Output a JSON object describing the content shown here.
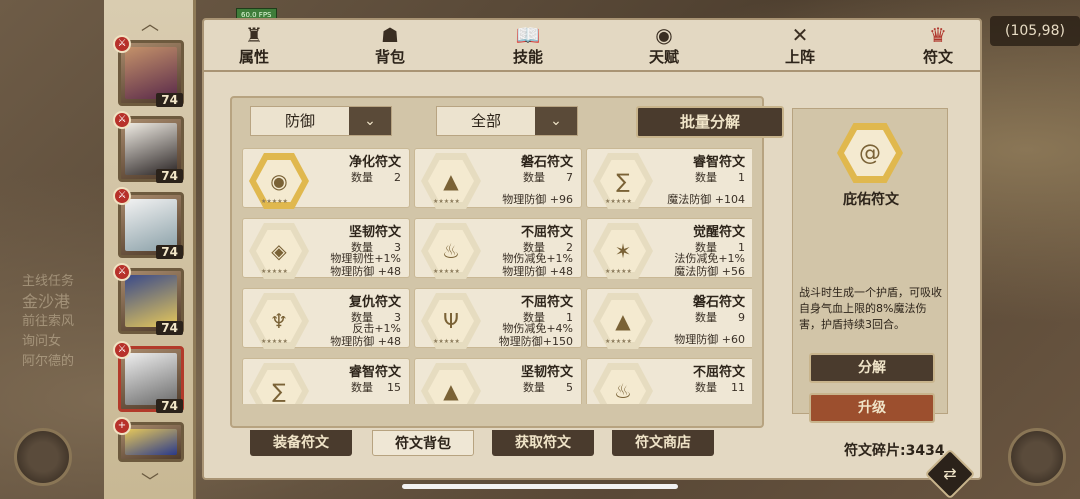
{
  "fps": "60.0 FPS",
  "coins": "(105,98)",
  "background_text": {
    "line1": "主线任务",
    "line2": "金沙港",
    "line3": "前往索风",
    "line4": "询问女",
    "line5": "阿尔德的"
  },
  "heroes": [
    {
      "level": "74"
    },
    {
      "level": "74"
    },
    {
      "level": "74"
    },
    {
      "level": "74"
    },
    {
      "level": "74"
    },
    {
      "level": ""
    }
  ],
  "tabs": [
    {
      "label": "属性",
      "icon": "attribute-icon"
    },
    {
      "label": "背包",
      "icon": "backpack-icon"
    },
    {
      "label": "技能",
      "icon": "skill-book-icon"
    },
    {
      "label": "天赋",
      "icon": "talent-eye-icon"
    },
    {
      "label": "上阵",
      "icon": "crossed-swords-icon"
    },
    {
      "label": "符文",
      "icon": "rune-icon"
    }
  ],
  "filters": {
    "type": "防御",
    "scope": "全部"
  },
  "batch_decompose": "批量分解",
  "qty_label": "数量",
  "runes": [
    {
      "name": "净化符文",
      "qty": "2",
      "stats": [],
      "gold": true
    },
    {
      "name": "磐石符文",
      "qty": "7",
      "stats": [
        "物理防御 +96"
      ],
      "gold": false
    },
    {
      "name": "睿智符文",
      "qty": "1",
      "stats": [
        "魔法防御 +104"
      ],
      "gold": false
    },
    {
      "name": "坚韧符文",
      "qty": "3",
      "stats": [
        "物理韧性+1%",
        "物理防御 +48"
      ],
      "gold": false
    },
    {
      "name": "不屈符文",
      "qty": "2",
      "stats": [
        "物伤减免+1%",
        "物理防御 +48"
      ],
      "gold": false
    },
    {
      "name": "觉醒符文",
      "qty": "1",
      "stats": [
        "法伤减免+1%",
        "魔法防御 +56"
      ],
      "gold": false
    },
    {
      "name": "复仇符文",
      "qty": "3",
      "stats": [
        "反击+1%",
        "物理防御 +48"
      ],
      "gold": false
    },
    {
      "name": "不屈符文",
      "qty": "1",
      "stats": [
        "物伤减免+4%",
        "物理防御+150"
      ],
      "gold": false
    },
    {
      "name": "磐石符文",
      "qty": "9",
      "stats": [
        "物理防御 +60"
      ],
      "gold": false
    },
    {
      "name": "睿智符文",
      "qty": "15",
      "stats": [],
      "gold": false
    },
    {
      "name": "坚韧符文",
      "qty": "5",
      "stats": [],
      "gold": false
    },
    {
      "name": "不屈符文",
      "qty": "11",
      "stats": [],
      "gold": false
    }
  ],
  "bottom_tabs": [
    "装备符文",
    "符文背包",
    "获取符文",
    "符文商店"
  ],
  "fragments": "符文碎片:3434",
  "detail": {
    "title": "庇佑符文",
    "description": "战斗时生成一个护盾，可吸收自身气血上限的8%魔法伤害，护盾持续3回合。",
    "decompose": "分解",
    "upgrade": "升级"
  },
  "colors": {
    "panel": "#e3d8c2",
    "dark_button": "#4a3b2d",
    "upgrade_button": "#9c4f2e",
    "active_tab_icon": "#b0362c",
    "gold_rune": "#e0b84e"
  }
}
